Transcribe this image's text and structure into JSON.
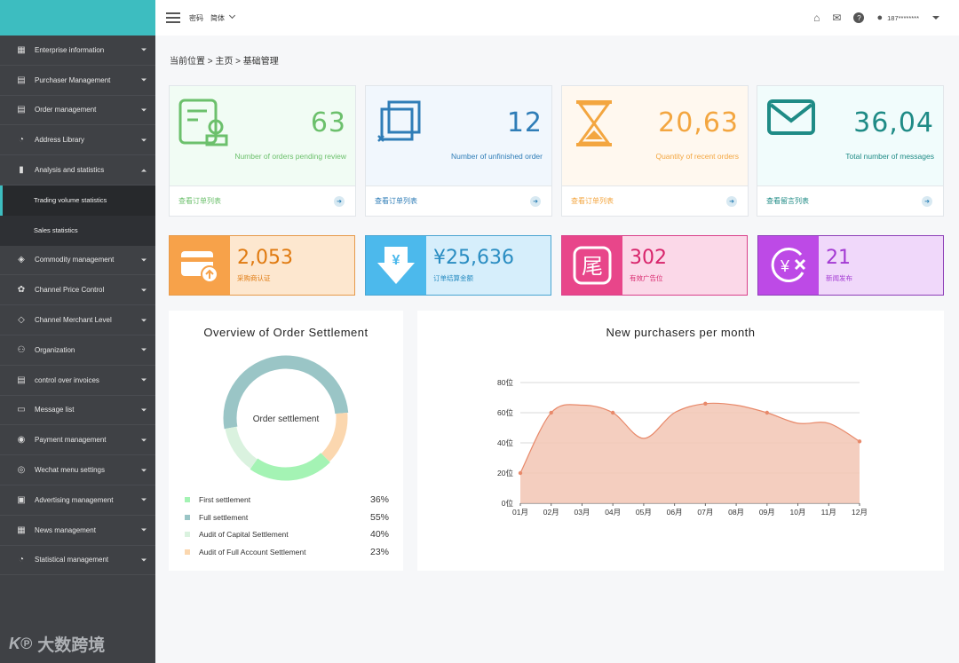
{
  "sidebar": {
    "items": [
      {
        "label": "Enterprise information",
        "icon": "building-icon"
      },
      {
        "label": "Purchaser Management",
        "icon": "clipboard-icon"
      },
      {
        "label": "Order management",
        "icon": "order-icon"
      },
      {
        "label": "Address Library",
        "icon": "user-icon"
      },
      {
        "label": "Analysis and statistics",
        "icon": "bar-chart-icon",
        "expanded": true,
        "children": [
          {
            "label": "Trading volume statistics",
            "active": true
          },
          {
            "label": "Sales statistics"
          }
        ]
      },
      {
        "label": "Commodity management",
        "icon": "layers-icon"
      },
      {
        "label": "Channel Price Control",
        "icon": "settings-icon"
      },
      {
        "label": "Channel Merchant Level",
        "icon": "diamond-icon"
      },
      {
        "label": "Organization",
        "icon": "org-icon"
      },
      {
        "label": "control over invoices",
        "icon": "invoice-icon"
      },
      {
        "label": "Message list",
        "icon": "message-icon"
      },
      {
        "label": "Payment management",
        "icon": "payment-icon"
      },
      {
        "label": "Wechat menu settings",
        "icon": "wechat-icon"
      },
      {
        "label": "Advertising management",
        "icon": "ad-icon"
      },
      {
        "label": "News management",
        "icon": "news-icon"
      },
      {
        "label": "Statistical management",
        "icon": "pie-icon"
      }
    ],
    "logo_text": "大数跨境"
  },
  "topbar": {
    "password": "密码",
    "language": "简体",
    "user": "187********"
  },
  "breadcrumb": "当前位置 > 主页 > 基础管理",
  "cards": [
    {
      "value": "63",
      "label": "Number of orders pending review",
      "link": "查看订单列表",
      "color": "#6cc06c",
      "bg": "#f1fcf4"
    },
    {
      "value": "12",
      "label": "Number of unfinished order",
      "link": "查看订单列表",
      "color": "#2f7db7",
      "bg": "#f1f7fd"
    },
    {
      "value": "20,63",
      "label": "Quantity of recent orders",
      "link": "查看订单列表",
      "color": "#f3a640",
      "bg": "#fff8ef"
    },
    {
      "value": "36,04",
      "label": "Total number of messages",
      "link": "查看留言列表",
      "color": "#1f8b86",
      "bg": "#f1fcfc"
    }
  ],
  "stats": [
    {
      "value": "2,053",
      "label": "采购商认证",
      "color": "#e07a10",
      "sq": "#f7a24a",
      "bg": "#fde7cf",
      "border": "#e69a4b"
    },
    {
      "value": "¥25,636",
      "label": "订单结算金额",
      "color": "#2a8dc2",
      "sq": "#4cb9ec",
      "bg": "#d6eefb",
      "border": "#4aa5d2"
    },
    {
      "value": "302",
      "label": "有效广告位",
      "color": "#d8246b",
      "sq": "#e8468a",
      "bg": "#fbd8e8",
      "border": "#d9408a"
    },
    {
      "value": "21",
      "label": "新闻发布",
      "color": "#a33ad3",
      "sq": "#bd4ae6",
      "bg": "#f0d8fa",
      "border": "#8d3fb8"
    }
  ],
  "donut": {
    "title": "Overview of Order Settlement",
    "center": "Order settlement",
    "legend": [
      {
        "name": "First settlement",
        "pct": "36%",
        "color": "#a4f3b4"
      },
      {
        "name": "Full settlement",
        "pct": "55%",
        "color": "#9ac5c6"
      },
      {
        "name": "Audit of Capital Settlement",
        "pct": "40%",
        "color": "#daf2df"
      },
      {
        "name": "Audit of Full Account Settlement",
        "pct": "23%",
        "color": "#fbd7af"
      }
    ]
  },
  "chart_data": {
    "type": "area",
    "title": "New purchasers per month",
    "categories": [
      "01月",
      "02月",
      "03月",
      "04月",
      "05月",
      "06月",
      "07月",
      "08月",
      "09月",
      "10月",
      "11月",
      "12月"
    ],
    "y_ticks": [
      "0位",
      "20位",
      "40位",
      "60位",
      "80位"
    ],
    "ylim": [
      0,
      80
    ],
    "values": [
      20,
      60,
      65,
      60,
      43,
      60,
      66,
      65,
      60,
      53,
      53,
      41
    ],
    "marked_points": [
      0,
      1,
      3,
      6,
      8,
      11
    ],
    "color": "#e8896a",
    "fill": "#f2c6b4"
  }
}
